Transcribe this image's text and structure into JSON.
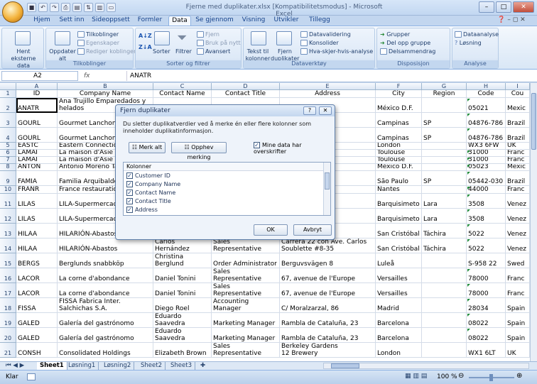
{
  "window": {
    "title": "Fjerne med duplikater.xlsx [Kompatibilitetsmodus] - Microsoft Excel"
  },
  "ribbon_tabs": [
    "Hjem",
    "Sett inn",
    "Sideoppsett",
    "Formler",
    "Data",
    "Se gjennom",
    "Visning",
    "Utvikler",
    "Tillegg"
  ],
  "ribbon": {
    "hent": "Hent eksterne\ndata",
    "oppdater": "Oppdater\nalt",
    "tilkoblinger": "Tilkoblinger",
    "egenskaper": "Egenskaper",
    "rediger": "Rediger koblinger",
    "grp_tilkoblinger": "Tilkoblinger",
    "sorter": "Sorter",
    "filtrer": "Filtrer",
    "fjern": "Fjern",
    "bruk": "Bruk på nytt",
    "avansert": "Avansert",
    "grp_sorter": "Sorter og filtrer",
    "tekst": "Tekst til\nkolonner",
    "fjern_dup": "Fjern\nduplikater",
    "validering": "Datavalidering",
    "konsolider": "Konsolider",
    "hvis": "Hva-skjer-hvis-analyse",
    "grp_verktoy": "Dataverktøy",
    "grupper": "Grupper",
    "del": "Del opp gruppe",
    "delsum": "Delsammendrag",
    "grp_disp": "Disposisjon",
    "analyse": "Dataanalyse",
    "losning": "Løsning",
    "grp_analyse": "Analyse"
  },
  "formula_bar": {
    "name_box": "A2",
    "fx": "fx",
    "value": "ANATR"
  },
  "columns": [
    "A",
    "B",
    "C",
    "D",
    "E",
    "F",
    "G",
    "H",
    "I"
  ],
  "header_row": [
    "Customer ID",
    "Company Name",
    "Contact Name",
    "Contact Title",
    "Address",
    "City",
    "Region",
    "Postal Code",
    "Cou"
  ],
  "rows": [
    {
      "num": "2",
      "cells": [
        "ANATR",
        "Ana Trujillo Emparedados y\nhelados",
        "",
        "",
        "...itución 2222",
        "México D.F.",
        "",
        "05021",
        "Mexic"
      ]
    },
    {
      "num": "3",
      "cells": [
        "GOURL",
        "Gourmet Lanchone",
        "",
        "",
        "",
        "Campinas",
        "SP",
        "04876-786",
        "Brazil"
      ]
    },
    {
      "num": "4",
      "cells": [
        "GOURL",
        "Gourmet Lanchone",
        "",
        "",
        "",
        "Campinas",
        "SP",
        "04876-786",
        "Brazil"
      ]
    },
    {
      "num": "5",
      "cells": [
        "EASTC",
        "Eastern Connectio",
        "",
        "",
        "",
        "London",
        "",
        "WX3 6FW",
        "UK"
      ]
    },
    {
      "num": "6",
      "cells": [
        "LAMAI",
        "La maison d'Asie",
        "",
        "",
        "ine",
        "Toulouse",
        "",
        "31000",
        "Franc"
      ]
    },
    {
      "num": "7",
      "cells": [
        "LAMAI",
        "La maison d'Asie",
        "",
        "",
        "ine",
        "Toulouse",
        "",
        "31000",
        "Franc"
      ]
    },
    {
      "num": "8",
      "cells": [
        "ANTON",
        "Antonio Moreno Ta",
        "",
        "",
        "",
        "México D.F.",
        "",
        "05023",
        "Mexic"
      ]
    },
    {
      "num": "9",
      "cells": [
        "FAMIA",
        "Familia Arquibaldo",
        "",
        "",
        "",
        "São Paulo",
        "SP",
        "05442-030",
        "Brazil"
      ]
    },
    {
      "num": "10",
      "cells": [
        "FRANR",
        "France restauratio",
        "",
        "",
        "",
        "Nantes",
        "",
        "44000",
        "Franc"
      ]
    },
    {
      "num": "11",
      "cells": [
        "LILAS",
        "LILA-Supermercado",
        "",
        "",
        "e. Bolívar",
        "Barquisimeto",
        "Lara",
        "3508",
        "Venez"
      ]
    },
    {
      "num": "12",
      "cells": [
        "LILAS",
        "LILA-Supermercado",
        "",
        "",
        "e. Bolívar",
        "Barquisimeto",
        "Lara",
        "3508",
        "Venez"
      ]
    },
    {
      "num": "13",
      "cells": [
        "HILAA",
        "HILARIÓN-Abastos",
        "Hernández",
        "Sales Representative",
        "e. Carlos",
        "San Cristóbal",
        "Táchira",
        "5022",
        "Venez"
      ]
    },
    {
      "num": "14",
      "cells": [
        "HILAA",
        "HILARIÓN-Abastos",
        "Carlos\nHernández",
        "Sales Representative",
        "Carrera 22 con Ave. Carlos\nSoublette #8-35",
        "San Cristóbal",
        "Táchira",
        "5022",
        "Venez"
      ]
    },
    {
      "num": "15",
      "cells": [
        "BERGS",
        "Berglunds snabbköp",
        "Christina\nBerglund",
        "Order Administrator",
        "Berguvsvägen  8",
        "Luleå",
        "",
        "S-958 22",
        "Swed"
      ]
    },
    {
      "num": "16",
      "cells": [
        "LACOR",
        "La corne d'abondance",
        "Daniel Tonini",
        "Sales Representative",
        "67, avenue de l'Europe",
        "Versailles",
        "",
        "78000",
        "Franc"
      ]
    },
    {
      "num": "17",
      "cells": [
        "LACOR",
        "La corne d'abondance",
        "Daniel Tonini",
        "Sales Representative",
        "67, avenue de l'Europe",
        "Versailles",
        "",
        "78000",
        "Franc"
      ]
    },
    {
      "num": "18",
      "cells": [
        "FISSA",
        "FISSA Fabrica Inter.\nSalchichas S.A.",
        "Diego Roel",
        "Accounting Manager",
        "C/ Moralzarzal, 86",
        "Madrid",
        "",
        "28034",
        "Spain"
      ]
    },
    {
      "num": "19",
      "cells": [
        "GALED",
        "Galería del gastrónomo",
        "Eduardo\nSaavedra",
        "Marketing Manager",
        "Rambla de Cataluña, 23",
        "Barcelona",
        "",
        "08022",
        "Spain"
      ]
    },
    {
      "num": "20",
      "cells": [
        "GALED",
        "Galería del gastrónomo",
        "Eduardo\nSaavedra",
        "Marketing Manager",
        "Rambla de Cataluña, 23",
        "Barcelona",
        "",
        "08022",
        "Spain"
      ]
    },
    {
      "num": "21",
      "cells": [
        "CONSH",
        "Consolidated Holdings",
        "Elizabeth Brown",
        "Sales Representative",
        "Berkeley Gardens\n12  Brewery",
        "London",
        "",
        "WX1 6LT",
        "UK"
      ]
    }
  ],
  "sheets": [
    "Sheet1",
    "Løsning1",
    "Løsning2",
    "Sheet2",
    "Sheet3"
  ],
  "status": {
    "mode": "Klar",
    "zoom": "100 %"
  },
  "dialog": {
    "title": "Fjern duplikater",
    "desc": "Du sletter duplikatverdier ved å merke én eller flere kolonner som inneholder duplikatinformasjon.",
    "select_all": "Merk alt",
    "unselect": "Opphev merking",
    "has_headers": "Mine data har overskrifter",
    "columns_label": "Kolonner",
    "items": [
      "Customer ID",
      "Company Name",
      "Contact Name",
      "Contact Title",
      "Address"
    ],
    "ok": "OK",
    "cancel": "Avbryt"
  }
}
